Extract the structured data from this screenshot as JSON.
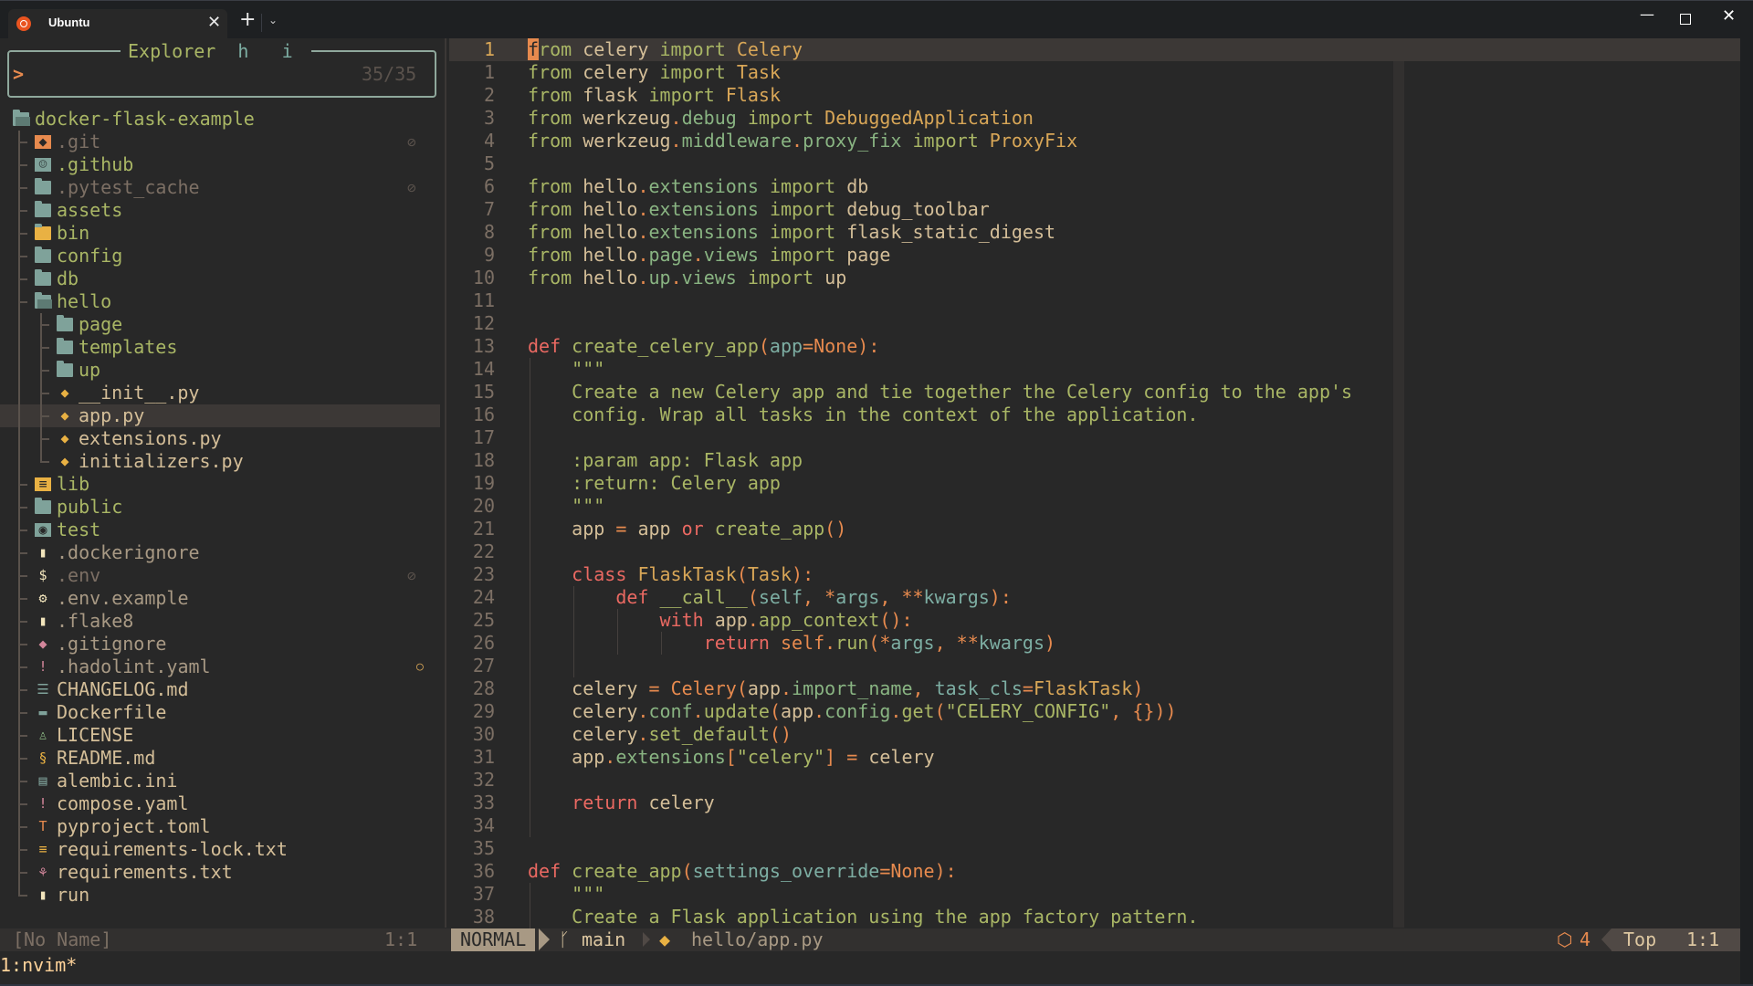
{
  "window": {
    "tab_title": "Ubuntu",
    "tab_icon": "ubuntu-icon",
    "new_tab": "+",
    "dropdown": "⌄",
    "close": "✕",
    "minimize": "—",
    "win_close": "✕"
  },
  "explorer": {
    "title": "Explorer",
    "hotkey_h": "h",
    "hotkey_i": "i",
    "prompt": ">",
    "count": "35/35",
    "root": "docker-flask-example",
    "items": [
      {
        "name": ".git",
        "icon": "git-folder-icon",
        "depth": 1,
        "hidden": true,
        "mark": "eye-off-icon"
      },
      {
        "name": ".github",
        "icon": "github-folder-icon",
        "depth": 1,
        "hidden": false
      },
      {
        "name": ".pytest_cache",
        "icon": "folder-icon",
        "depth": 1,
        "hidden": true,
        "mark": "eye-off-icon"
      },
      {
        "name": "assets",
        "icon": "folder-icon",
        "depth": 1
      },
      {
        "name": "bin",
        "icon": "bin-folder-icon",
        "depth": 1
      },
      {
        "name": "config",
        "icon": "folder-icon",
        "depth": 1
      },
      {
        "name": "db",
        "icon": "folder-icon",
        "depth": 1
      },
      {
        "name": "hello",
        "icon": "folder-open-icon",
        "depth": 1
      },
      {
        "name": "page",
        "icon": "folder-icon",
        "depth": 2
      },
      {
        "name": "templates",
        "icon": "folder-icon",
        "depth": 2
      },
      {
        "name": "up",
        "icon": "folder-icon",
        "depth": 2
      },
      {
        "name": "__init__.py",
        "icon": "python-icon",
        "depth": 2
      },
      {
        "name": "app.py",
        "icon": "python-icon",
        "depth": 2,
        "selected": true
      },
      {
        "name": "extensions.py",
        "icon": "python-icon",
        "depth": 2
      },
      {
        "name": "initializers.py",
        "icon": "python-icon",
        "depth": 2
      },
      {
        "name": "lib",
        "icon": "lib-folder-icon",
        "depth": 1
      },
      {
        "name": "public",
        "icon": "folder-icon",
        "depth": 1
      },
      {
        "name": "test",
        "icon": "test-folder-icon",
        "depth": 1
      },
      {
        "name": ".dockerignore",
        "icon": "file-icon",
        "depth": 1
      },
      {
        "name": ".env",
        "icon": "dollar-icon",
        "depth": 1,
        "hidden": true,
        "mark": "eye-off-icon"
      },
      {
        "name": ".env.example",
        "icon": "gear-icon",
        "depth": 1
      },
      {
        "name": ".flake8",
        "icon": "file-icon",
        "depth": 1
      },
      {
        "name": ".gitignore",
        "icon": "git-icon",
        "depth": 1
      },
      {
        "name": ".hadolint.yaml",
        "icon": "yaml-icon",
        "depth": 1,
        "mark": "modified-circle-icon"
      },
      {
        "name": "CHANGELOG.md",
        "icon": "list-icon",
        "depth": 1
      },
      {
        "name": "Dockerfile",
        "icon": "docker-icon",
        "depth": 1
      },
      {
        "name": "LICENSE",
        "icon": "license-icon",
        "depth": 1
      },
      {
        "name": "README.md",
        "icon": "readme-icon",
        "depth": 1
      },
      {
        "name": "alembic.ini",
        "icon": "ini-icon",
        "depth": 1
      },
      {
        "name": "compose.yaml",
        "icon": "yaml-icon",
        "depth": 1
      },
      {
        "name": "pyproject.toml",
        "icon": "toml-icon",
        "depth": 1
      },
      {
        "name": "requirements-lock.txt",
        "icon": "text-icon",
        "depth": 1
      },
      {
        "name": "requirements.txt",
        "icon": "dependency-icon",
        "depth": 1
      },
      {
        "name": "run",
        "icon": "file-icon",
        "depth": 1
      }
    ]
  },
  "editor": {
    "lines": [
      {
        "n": "1",
        "text": "from celery import Celery"
      },
      {
        "n": "1",
        "text": "from celery import Task"
      },
      {
        "n": "2",
        "text": "from flask import Flask"
      },
      {
        "n": "3",
        "text": "from werkzeug.debug import DebuggedApplication"
      },
      {
        "n": "4",
        "text": "from werkzeug.middleware.proxy_fix import ProxyFix"
      },
      {
        "n": "5",
        "text": ""
      },
      {
        "n": "6",
        "text": "from hello.extensions import db"
      },
      {
        "n": "7",
        "text": "from hello.extensions import debug_toolbar"
      },
      {
        "n": "8",
        "text": "from hello.extensions import flask_static_digest"
      },
      {
        "n": "9",
        "text": "from hello.page.views import page"
      },
      {
        "n": "10",
        "text": "from hello.up.views import up"
      },
      {
        "n": "11",
        "text": ""
      },
      {
        "n": "12",
        "text": ""
      },
      {
        "n": "13",
        "text": "def create_celery_app(app=None):"
      },
      {
        "n": "14",
        "text": "    \"\"\""
      },
      {
        "n": "15",
        "text": "    Create a new Celery app and tie together the Celery config to the app's"
      },
      {
        "n": "16",
        "text": "    config. Wrap all tasks in the context of the application."
      },
      {
        "n": "17",
        "text": ""
      },
      {
        "n": "18",
        "text": "    :param app: Flask app"
      },
      {
        "n": "19",
        "text": "    :return: Celery app"
      },
      {
        "n": "20",
        "text": "    \"\"\""
      },
      {
        "n": "21",
        "text": "    app = app or create_app()"
      },
      {
        "n": "22",
        "text": ""
      },
      {
        "n": "23",
        "text": "    class FlaskTask(Task):"
      },
      {
        "n": "24",
        "text": "        def __call__(self, *args, **kwargs):"
      },
      {
        "n": "25",
        "text": "            with app.app_context():"
      },
      {
        "n": "26",
        "text": "                return self.run(*args, **kwargs)"
      },
      {
        "n": "27",
        "text": ""
      },
      {
        "n": "28",
        "text": "    celery = Celery(app.import_name, task_cls=FlaskTask)"
      },
      {
        "n": "29",
        "text": "    celery.conf.update(app.config.get(\"CELERY_CONFIG\", {}))"
      },
      {
        "n": "30",
        "text": "    celery.set_default()"
      },
      {
        "n": "31",
        "text": "    app.extensions[\"celery\"] = celery"
      },
      {
        "n": "32",
        "text": ""
      },
      {
        "n": "33",
        "text": "    return celery"
      },
      {
        "n": "34",
        "text": ""
      },
      {
        "n": "35",
        "text": ""
      },
      {
        "n": "36",
        "text": "def create_app(settings_override=None):"
      },
      {
        "n": "37",
        "text": "    \"\"\""
      },
      {
        "n": "38",
        "text": "    Create a Flask application using the app factory pattern."
      }
    ]
  },
  "statusline": {
    "left_name": "[No Name]",
    "left_pos": "1:1",
    "mode": "NORMAL",
    "branch_icon": "git-branch-icon",
    "branch": "main",
    "file_icon": "python-icon",
    "file": "hello/app.py",
    "package_icon": "package-icon",
    "package_count": "4",
    "scroll": "Top",
    "position": "1:1"
  },
  "tmux": {
    "window": "1:nvim*"
  },
  "colors": {
    "background": "#282828",
    "accent_orange": "#e78a4e",
    "keyword_green": "#a9b665",
    "keyword_red": "#ea6962",
    "type_yellow": "#d8a657",
    "param_blue": "#7daea3"
  }
}
